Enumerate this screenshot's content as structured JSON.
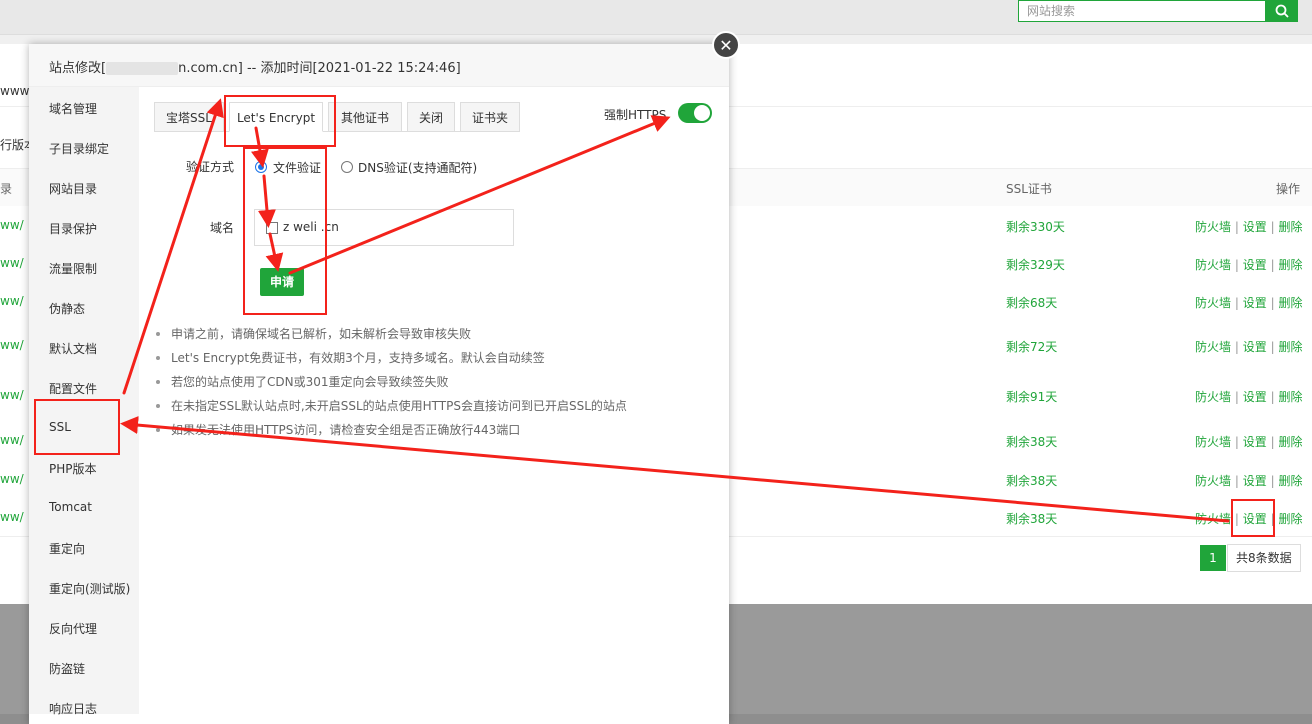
{
  "background": {
    "search_placeholder": "网站搜索",
    "search_icon": "search-icon",
    "left_fragments": [
      "www月",
      "行版本",
      "录"
    ],
    "table_header": {
      "ssl": "SSL证书",
      "operations": "操作"
    },
    "row_prefix": "ww/",
    "rows": [
      {
        "ssl": "剩余330天"
      },
      {
        "ssl": "剩余329天"
      },
      {
        "ssl": "剩余68天"
      },
      {
        "ssl": "剩余72天"
      },
      {
        "ssl": "剩余91天"
      },
      {
        "ssl": "剩余38天"
      },
      {
        "ssl": "剩余38天"
      },
      {
        "ssl": "剩余38天"
      }
    ],
    "ops": {
      "firewall": "防火墙",
      "settings": "设置",
      "delete": "删除",
      "separator": "|"
    },
    "pager": {
      "current": "1",
      "total": "共8条数据"
    }
  },
  "modal": {
    "title_prefix": "站点修改[",
    "title_suffix": "n.com.cn] -- 添加时间[2021-01-22 15:24:46]",
    "close_icon": "close-icon",
    "close_glyph": "✕",
    "sidebar": [
      "域名管理",
      "子目录绑定",
      "网站目录",
      "目录保护",
      "流量限制",
      "伪静态",
      "默认文档",
      "配置文件",
      "SSL",
      "PHP版本",
      "Tomcat",
      "重定向",
      "重定向(测试版)",
      "反向代理",
      "防盗链",
      "响应日志"
    ],
    "tabs": [
      "宝塔SSL",
      "Let's Encrypt",
      "其他证书",
      "关闭",
      "证书夹"
    ],
    "force_https_label": "强制HTTPS",
    "force_https_on": true,
    "verify_label": "验证方式",
    "verify_options": [
      "文件验证",
      "DNS验证(支持通配符)"
    ],
    "domain_label": "域名",
    "domain_value": "z    weli          .cn",
    "apply_button": "申请",
    "notes": [
      "申请之前，请确保域名已解析，如未解析会导致审核失败",
      "Let's Encrypt免费证书，有效期3个月，支持多域名。默认会自动续签",
      "若您的站点使用了CDN或301重定向会导致续签失败",
      "在未指定SSL默认站点时,未开启SSL的站点使用HTTPS会直接访问到已开启SSL的站点",
      "如果发无法使用HTTPS访问，请检查安全组是否正确放行443端口"
    ]
  },
  "colors": {
    "brand_green": "#20a53a",
    "annotation_red": "#f3221b"
  }
}
